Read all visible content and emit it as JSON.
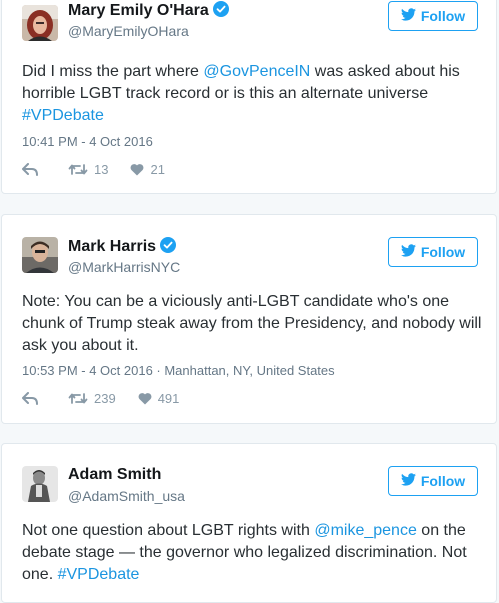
{
  "accent_color": "#1da1f2",
  "tweets": [
    {
      "name": "Mary Emily O'Hara",
      "handle": "@MaryEmilyOHara",
      "follow_label": "Follow",
      "text_segments": [
        {
          "text": "Did I miss the part where ",
          "link": false
        },
        {
          "text": "@GovPenceIN",
          "link": true
        },
        {
          "text": " was asked about his horrible LGBT track record or is this an alternate universe ",
          "link": false
        },
        {
          "text": "#VPDebate",
          "link": true
        }
      ],
      "meta": "10:41 PM - 4 Oct 2016",
      "retweets": "13",
      "likes": "21"
    },
    {
      "name": "Mark Harris",
      "handle": "@MarkHarrisNYC",
      "follow_label": "Follow",
      "text_segments": [
        {
          "text": "Note: You can be a viciously anti-LGBT candidate who's one chunk of Trump steak away from the Presidency, and nobody will ask you about it.",
          "link": false
        }
      ],
      "meta": "10:53 PM - 4 Oct 2016 · Manhattan, NY, United States",
      "retweets": "239",
      "likes": "491"
    },
    {
      "name": "Adam Smith",
      "handle": "@AdamSmith_usa",
      "follow_label": "Follow",
      "text_segments": [
        {
          "text": "Not one question about LGBT rights with ",
          "link": false
        },
        {
          "text": "@mike_pence",
          "link": true
        },
        {
          "text": " on the debate stage — the governor who legalized discrimination. Not one. ",
          "link": false
        },
        {
          "text": "#VPDebate",
          "link": true
        }
      ]
    }
  ]
}
